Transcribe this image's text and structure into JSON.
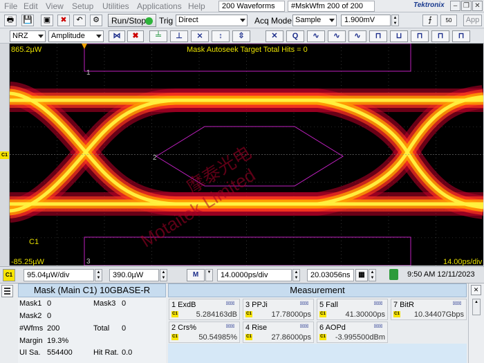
{
  "menubar": {
    "items": [
      "File",
      "Edit",
      "View",
      "Setup",
      "Utilities",
      "Applications",
      "Help"
    ],
    "waveforms": "200 Waveforms",
    "mskwfm": "#MskWfm  200 of 200",
    "brand": "Tektronix"
  },
  "toolbar": {
    "run_stop": "Run/Stop",
    "trig_label": "Trig",
    "trig_value": "Direct",
    "acq_label": "Acq Mode",
    "acq_value": "Sample",
    "threshold": "1.900mV",
    "app": "App",
    "fifty_ohm": "50"
  },
  "toolbar2": {
    "nrz": "NRZ",
    "amplitude": "Amplitude"
  },
  "screen": {
    "scale_top": "865.2µW",
    "scale_bottom": "-85.25µW",
    "channel_label": "C1",
    "time_div": "14.00ps/div",
    "hits_text": "Mask Autoseek Target Total Hits = 0",
    "mask_labels": [
      "1",
      "2",
      "3"
    ],
    "watermark_cn": "摩泰光电",
    "watermark_en": "Motaitek Limited",
    "colors": {
      "background": "#000000",
      "mask": "#c020c0",
      "scale_text": "#e8e000"
    }
  },
  "status": {
    "channel": "C1",
    "vert_scale": "95.04µW/div",
    "vert_offset": "390.0µW",
    "m_label": "M",
    "time_scale": "14.0000ps/div",
    "time_pos": "20.03056ns",
    "datetime": "9:50 AM 12/11/2023"
  },
  "mask_panel": {
    "title": "Mask (Main  C1) 10GBASE-R",
    "rows": [
      {
        "label": "Mask1",
        "value": "0",
        "label2": "Mask3",
        "value2": "0"
      },
      {
        "label": "Mask2",
        "value": "0",
        "label2": "",
        "value2": ""
      },
      {
        "label": "#Wfms",
        "value": "200",
        "label2": "Total",
        "value2": "0"
      },
      {
        "label": "Margin",
        "value": "19.3%",
        "label2": "",
        "value2": ""
      },
      {
        "label": "UI Sa.",
        "value": "554400",
        "label2": "Hit Rat.",
        "value2": "0.0"
      }
    ]
  },
  "measurement": {
    "title": "Measurement",
    "items": [
      {
        "label": "1 ExdB",
        "value": "5.284163dB"
      },
      {
        "label": "3 PPJi",
        "value": "17.78000ps"
      },
      {
        "label": "5 Fall",
        "value": "41.30000ps"
      },
      {
        "label": "7 BitR",
        "value": "10.34407Gbps"
      },
      {
        "label": "2 Crs%",
        "value": "50.54985%"
      },
      {
        "label": "4 Rise",
        "value": "27.86000ps"
      },
      {
        "label": "6 AOPd",
        "value": "-3.995500dBm"
      }
    ],
    "channel_tag": "C1"
  }
}
